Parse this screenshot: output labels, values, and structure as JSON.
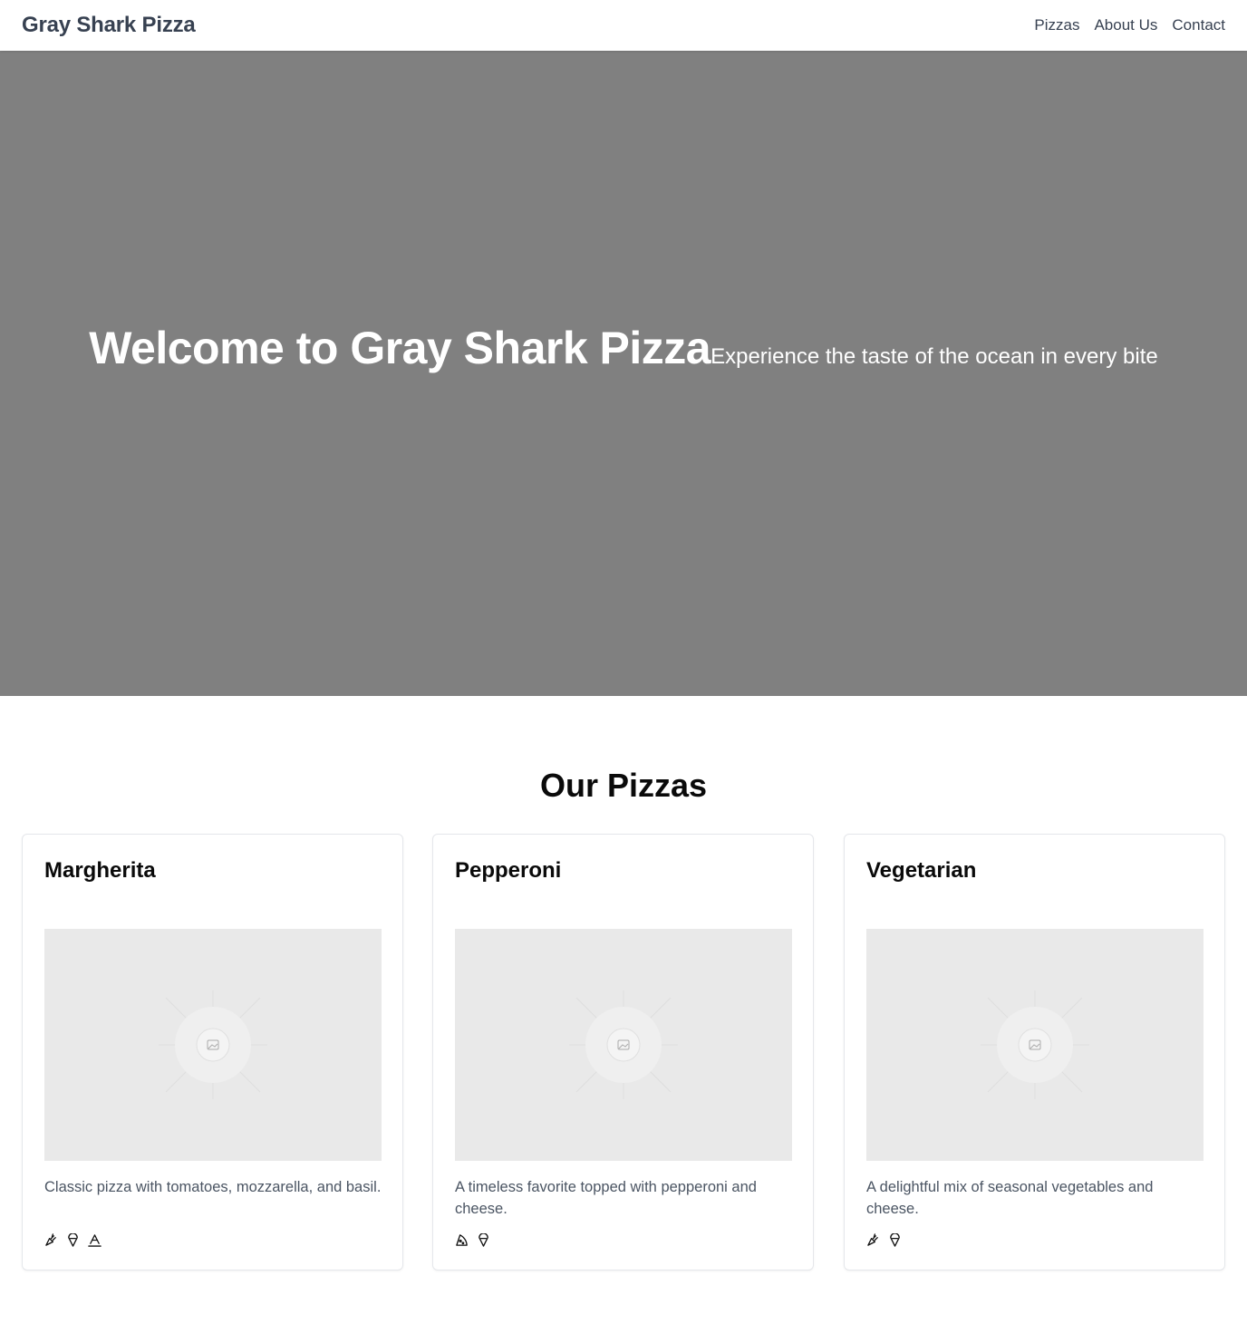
{
  "nav": {
    "brand": "Gray Shark Pizza",
    "links": [
      "Pizzas",
      "About Us",
      "Contact"
    ]
  },
  "hero": {
    "title": "Welcome to Gray Shark Pizza",
    "subtitle": "Experience the taste of the ocean in every bite"
  },
  "menu": {
    "title": "Our Pizzas",
    "cards": [
      {
        "name": "Margherita",
        "description": "Classic pizza with tomatoes, mozzarella, and basil.",
        "icons": [
          "carrot-icon",
          "vegan-icon",
          "wheat-icon"
        ]
      },
      {
        "name": "Pepperoni",
        "description": "A timeless favorite topped with pepperoni and cheese.",
        "icons": [
          "pizza-slice-icon",
          "vegan-icon"
        ]
      },
      {
        "name": "Vegetarian",
        "description": "A delightful mix of seasonal vegetables and cheese.",
        "icons": [
          "carrot-icon",
          "vegan-icon"
        ]
      }
    ]
  },
  "colors": {
    "hero_bg": "#808080",
    "image_placeholder": "#e9e9e9",
    "nav_text": "#374151"
  }
}
